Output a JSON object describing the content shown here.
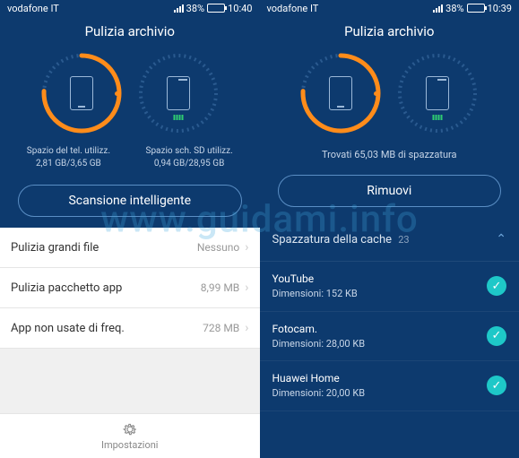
{
  "watermark": "www.guidami.info",
  "left": {
    "status": {
      "carrier": "vodafone IT",
      "battery_pct": "38%",
      "time": "10:40"
    },
    "title": "Pulizia archivio",
    "storage": {
      "phone": {
        "label": "Spazio del tel. utilizz.",
        "value": "2,81 GB/3,65 GB"
      },
      "sd": {
        "label": "Spazio sch. SD utilizz.",
        "value": "0,94 GB/28,95 GB"
      }
    },
    "scan_button": "Scansione intelligente",
    "rows": [
      {
        "label": "Pulizia grandi file",
        "value": "Nessuno"
      },
      {
        "label": "Pulizia pacchetto app",
        "value": "8,99 MB"
      },
      {
        "label": "App non usate di freq.",
        "value": "728 MB"
      }
    ],
    "settings_label": "Impostazioni"
  },
  "right": {
    "status": {
      "carrier": "vodafone IT",
      "battery_pct": "38%",
      "time": "10:39"
    },
    "title": "Pulizia archivio",
    "found_text": "Trovati 65,03 MB di spazzatura",
    "scan_button": "Rimuovi",
    "cache_header": "Spazzatura della cache",
    "cache_count": "23",
    "cache_items": [
      {
        "name": "YouTube",
        "size": "Dimensioni: 152 KB"
      },
      {
        "name": "Fotocam.",
        "size": "Dimensioni: 28,00 KB"
      },
      {
        "name": "Huawei Home",
        "size": "Dimensioni: 20,00 KB"
      }
    ]
  }
}
